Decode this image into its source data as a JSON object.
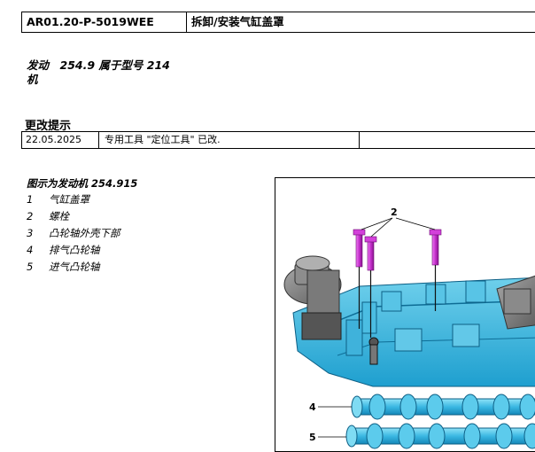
{
  "header": {
    "code": "AR01.20-P-5019WEE",
    "title": "拆卸/安装气缸盖罩"
  },
  "engine_title": "发动　254.9 属于型号 214\n机",
  "changes": {
    "heading": "更改提示",
    "rows": [
      {
        "date": "22.05.2025",
        "text": "专用工具 \"定位工具\" 已改.",
        "extra": ""
      }
    ]
  },
  "figure": {
    "caption": "图示为发动机 254.915",
    "legend": [
      {
        "num": "1",
        "label": "气缸盖罩"
      },
      {
        "num": "2",
        "label": "螺栓"
      },
      {
        "num": "3",
        "label": "凸轮轴外壳下部"
      },
      {
        "num": "4",
        "label": "排气凸轮轴"
      },
      {
        "num": "5",
        "label": "进气凸轮轴"
      }
    ],
    "callouts": {
      "bolts": "2",
      "exhaust": "4",
      "intake": "5"
    }
  }
}
